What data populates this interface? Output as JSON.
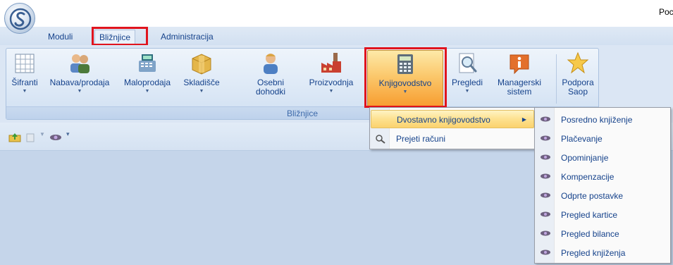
{
  "window": {
    "title_partial": "Poc"
  },
  "tabs": [
    {
      "label": "Moduli"
    },
    {
      "label": "Bližnjice"
    },
    {
      "label": "Administracija"
    }
  ],
  "ribbon": {
    "group_label": "Bližnjice",
    "buttons": [
      {
        "line1": "Šifranti",
        "line2": "",
        "icon": "table-grid-icon"
      },
      {
        "line1": "Nabava/prodaja",
        "line2": "",
        "icon": "people-icon"
      },
      {
        "line1": "Maloprodaja",
        "line2": "",
        "icon": "cash-register-icon"
      },
      {
        "line1": "Skladišče",
        "line2": "",
        "icon": "box-icon"
      },
      {
        "line1": "Osebni",
        "line2": "dohodki",
        "icon": "person-icon"
      },
      {
        "line1": "Proizvodnja",
        "line2": "",
        "icon": "factory-icon"
      },
      {
        "line1": "Knjigovodstvo",
        "line2": "",
        "icon": "calculator-icon"
      },
      {
        "line1": "Pregledi",
        "line2": "",
        "icon": "magnifier-document-icon"
      },
      {
        "line1": "Managerski",
        "line2": "sistem",
        "icon": "info-icon"
      },
      {
        "line1": "Podpora",
        "line2": "Saop",
        "icon": "star-icon"
      }
    ]
  },
  "dropdown": {
    "items": [
      {
        "label": "Dvostavno knjigovodstvo"
      },
      {
        "label": "Prejeti računi"
      }
    ]
  },
  "submenu": {
    "items": [
      {
        "label": "Posredno knjiženje"
      },
      {
        "label": "Plačevanje"
      },
      {
        "label": "Opominjanje"
      },
      {
        "label": "Kompenzacije"
      },
      {
        "label": "Odprte postavke"
      },
      {
        "label": "Pregled kartice"
      },
      {
        "label": "Pregled bilance"
      },
      {
        "label": "Pregled knjiženja"
      }
    ]
  },
  "colors": {
    "highlight": "#e0141e",
    "selected_button": "#f79a2c",
    "background": "#c5d5ea"
  }
}
